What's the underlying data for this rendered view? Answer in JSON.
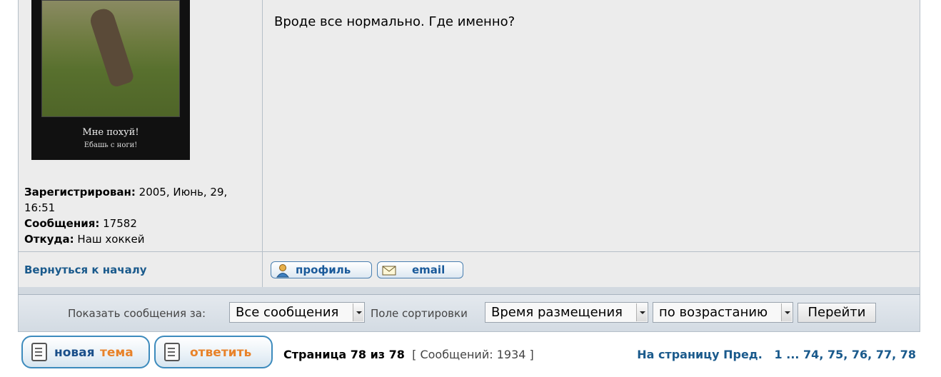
{
  "post": {
    "avatar_caption_1": "Мне похуй!",
    "avatar_caption_2": "Ебашь с ноги!",
    "registered_label": "Зарегистрирован:",
    "registered_value": "2005, Июнь, 29, 16:51",
    "posts_label": "Сообщения:",
    "posts_value": "17582",
    "from_label": "Откуда:",
    "from_value": "Наш хоккей",
    "message": "Вроде все нормально. Где именно?"
  },
  "post_footer": {
    "back_to_top": "Вернуться к началу",
    "profile_button": "профиль",
    "email_button": "email"
  },
  "sort_bar": {
    "show_label": "Показать сообщения за:",
    "show_value": "Все сообщения",
    "sort_label": "Поле сортировки",
    "sort_value": "Время размещения",
    "order_value": "по возрастанию",
    "go_button": "Перейти"
  },
  "actions": {
    "new_topic_1": "новая",
    "new_topic_2": "тема",
    "reply": "ответить"
  },
  "page_info": {
    "page_text": "Страница 78 из 78",
    "posts_count": "[ Сообщений: 1934 ]"
  },
  "pagination": {
    "label": "На страницу",
    "prev": "Пред.",
    "first": "1",
    "ellipsis": "...",
    "pages": [
      "74",
      "75",
      "76",
      "77",
      "78"
    ]
  },
  "colors": {
    "link": "#1a5a8c",
    "button_border": "#3d8bbd",
    "accent_orange": "#e8822a"
  }
}
